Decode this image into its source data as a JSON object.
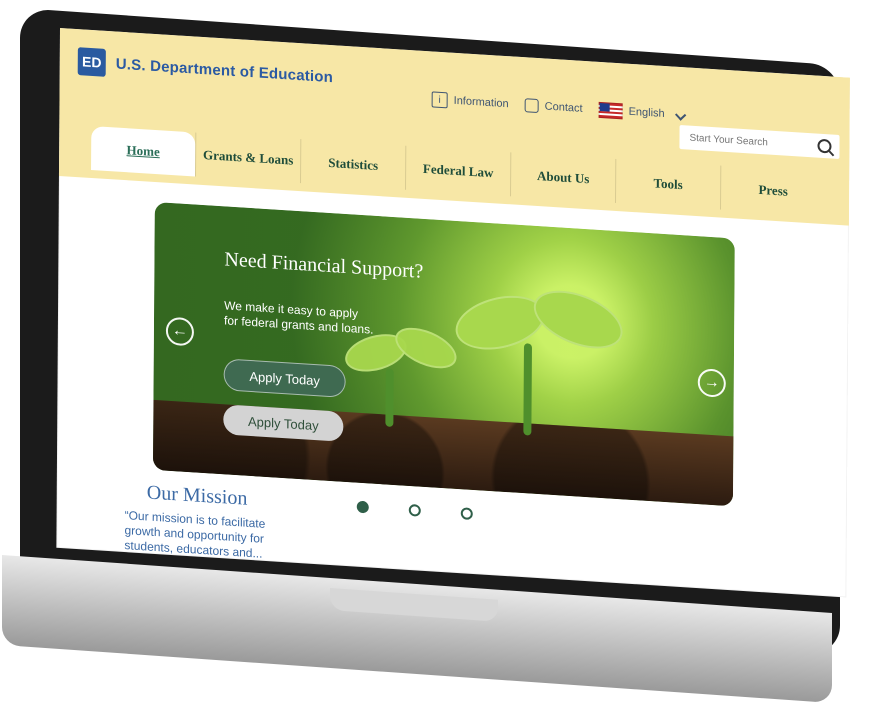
{
  "header": {
    "brand": {
      "logo_text": "ED",
      "title": "U.S. Department of Education"
    },
    "utility": {
      "information_label": "Information",
      "contact_label": "Contact",
      "language_label": "English"
    },
    "search": {
      "placeholder": "Start Your Search"
    },
    "nav_tabs": [
      {
        "label": "Home"
      },
      {
        "label": "Grants & Loans"
      },
      {
        "label": "Statistics"
      },
      {
        "label": "Federal Law"
      },
      {
        "label": "About Us"
      },
      {
        "label": "Tools"
      },
      {
        "label": "Press"
      }
    ]
  },
  "hero": {
    "title": "Need Financial Support?",
    "text": "We make it easy to apply for federal grants and loans.",
    "buttons": [
      {
        "label": "Apply Today"
      },
      {
        "label": "Apply Today"
      }
    ],
    "carousel": {
      "total": 3,
      "active_index": 0
    }
  },
  "mission": {
    "title": "Our Mission",
    "text": "“Our mission is to facilitate growth and opportunity for students, educators and..."
  }
}
